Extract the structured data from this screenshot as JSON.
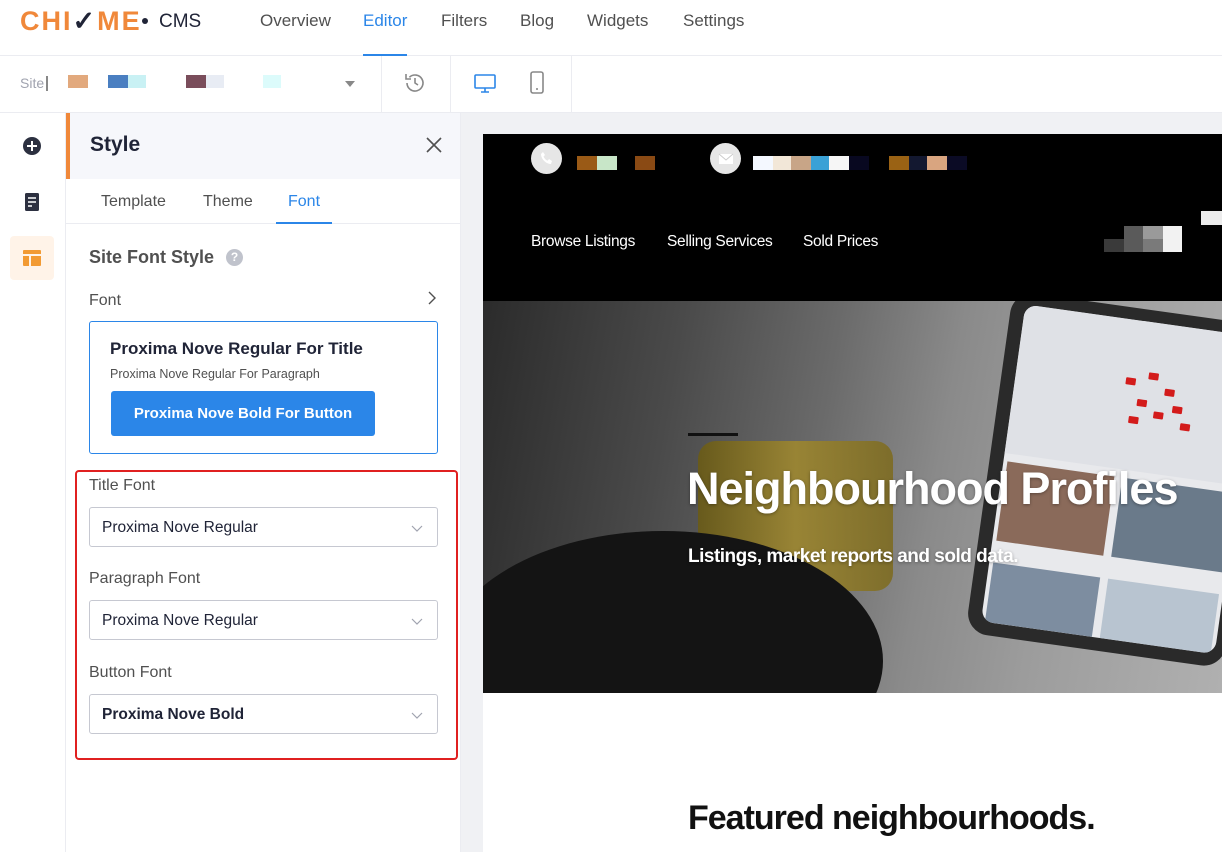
{
  "brand": {
    "logo_pre": "CHI",
    "logo_mark": "✓",
    "logo_post": "ME",
    "product": "CMS"
  },
  "nav": {
    "tabs": [
      {
        "label": "Overview",
        "active": false
      },
      {
        "label": "Editor",
        "active": true
      },
      {
        "label": "Filters",
        "active": false
      },
      {
        "label": "Blog",
        "active": false
      },
      {
        "label": "Widgets",
        "active": false
      },
      {
        "label": "Settings",
        "active": false
      }
    ]
  },
  "toolbar": {
    "site_label": "Site",
    "site_value_redacted": true,
    "icons": [
      "history-icon",
      "desktop-view-icon",
      "mobile-view-icon"
    ],
    "active_view": "desktop"
  },
  "rail": {
    "items": [
      {
        "icon": "add-circle-icon",
        "active": false
      },
      {
        "icon": "page-icon",
        "active": false
      },
      {
        "icon": "layout-icon",
        "active": true
      }
    ]
  },
  "panel": {
    "title": "Style",
    "tabs": [
      {
        "label": "Template",
        "active": false
      },
      {
        "label": "Theme",
        "active": false
      },
      {
        "label": "Font",
        "active": true
      }
    ],
    "section_title": "Site Font Style",
    "help_glyph": "?",
    "font_row_label": "Font",
    "preview": {
      "title": "Proxima Nove Regular For Title",
      "paragraph": "Proxima Nove Regular For Paragraph",
      "button": "Proxima Nove Bold For Button"
    },
    "fields": [
      {
        "label": "Title Font",
        "value": "Proxima Nove Regular"
      },
      {
        "label": "Paragraph Font",
        "value": "Proxima Nove Regular"
      },
      {
        "label": "Button Font",
        "value": "Proxima Nove Bold"
      }
    ]
  },
  "site_preview": {
    "nav": [
      "Browse Listings",
      "Selling Services",
      "Sold Prices"
    ],
    "hero_title": "Neighbourhood Profiles",
    "hero_subtitle": "Listings, market reports and sold data.",
    "featured_heading": "Featured neighbourhoods."
  },
  "colors": {
    "accent": "#2b86e8",
    "brand_orange": "#f0883a",
    "highlight_border": "#e02020",
    "text_dark": "#202437"
  }
}
